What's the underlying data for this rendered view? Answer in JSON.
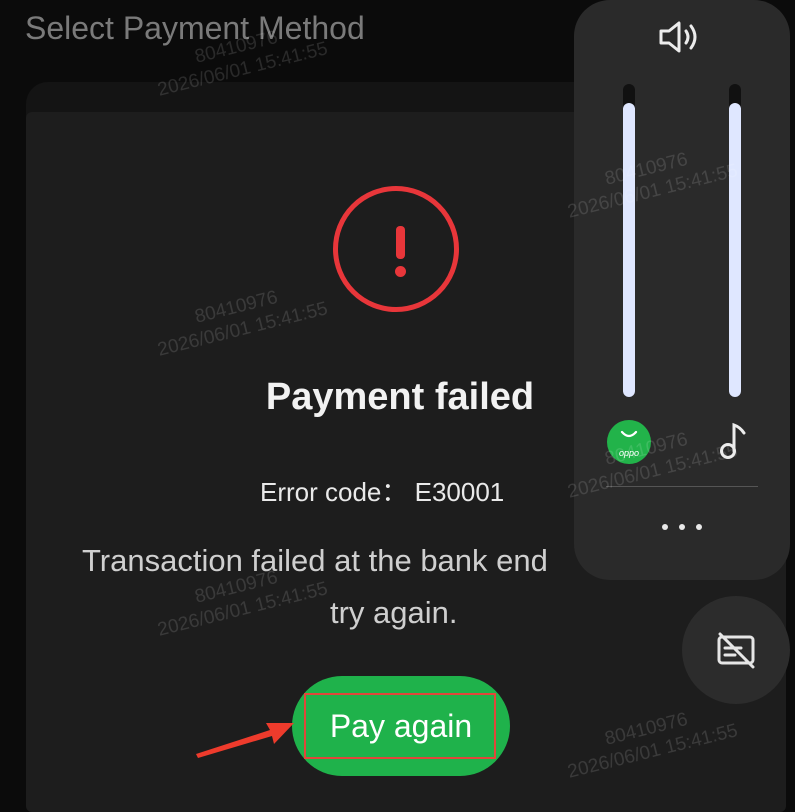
{
  "page": {
    "title": "Select Payment Method"
  },
  "result": {
    "title": "Payment failed",
    "error_code": "Error code： E30001",
    "message_line1": "Transaction failed at the bank end",
    "message_line2": "try again.",
    "pay_again_label": "Pay again",
    "status_color": "#e8363a",
    "accent_color": "#1fb24b"
  },
  "volume_panel": {
    "speaker_icon": "speaker-volume-icon",
    "app_icon_label": "oppo",
    "app_volume_level": 0.94,
    "media_volume_level": 0.94,
    "music_icon": "music-note-icon",
    "more_icon": "more-dots-icon"
  },
  "subtitle_toggle": {
    "icon": "subtitles-off-icon"
  },
  "watermark": {
    "id": "80410976",
    "timestamp": "2026/06/01 15:41:55"
  }
}
